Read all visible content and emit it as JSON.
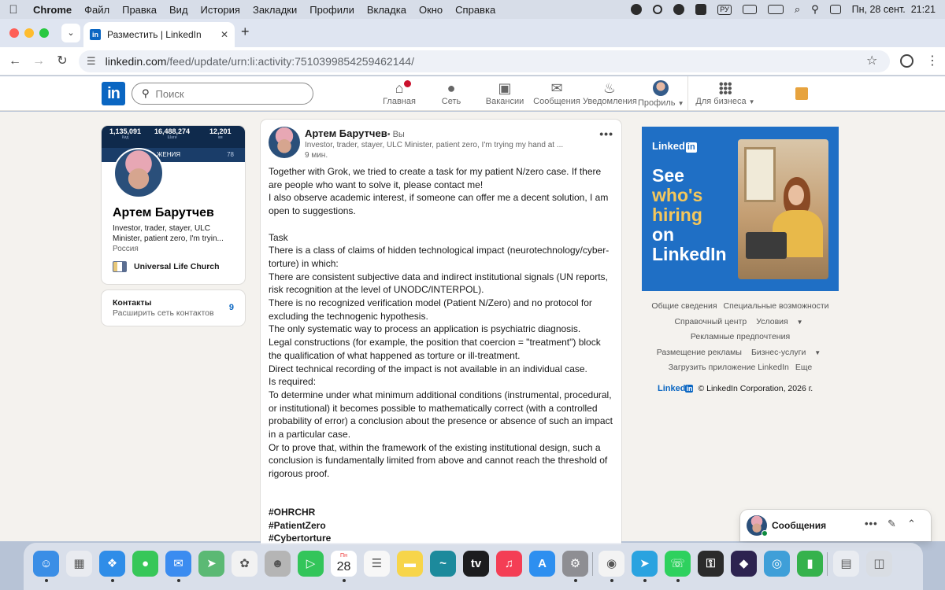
{
  "menubar": {
    "app": "Chrome",
    "items": [
      "Файл",
      "Правка",
      "Вид",
      "История",
      "Закладки",
      "Профили",
      "Вкладка",
      "Окно",
      "Справка"
    ],
    "input_lang": "РУ",
    "datetime": "Пн, 28 сент.  21:21"
  },
  "browser": {
    "tab_title": "Разместить | LinkedIn",
    "favicon_text": "in",
    "url_domain": "linkedin.com",
    "url_path": "/feed/update/urn:li:activity:7510399854259462144/"
  },
  "linkedin": {
    "logo": "in",
    "search_placeholder": "Поиск",
    "nav": {
      "home": "Главная",
      "network": "Сеть",
      "jobs": "Вакансии",
      "messaging": "Сообщения",
      "notifications": "Уведомления",
      "profile": "Профиль",
      "business": "Для бизнеса"
    },
    "profile_card": {
      "banner_stats": [
        {
          "value": "1,135,091",
          "label": "Кид"
        },
        {
          "value": "16,488,274",
          "label": "Шаги"
        },
        {
          "value": "12,201",
          "label": "км"
        }
      ],
      "banner_text": "ЖЕНИЯ",
      "banner_number": "78",
      "name": "Артем Барутчев",
      "headline": "Investor, trader, stayer, ULC Minister, patient zero, I'm tryin...",
      "location": "Россия",
      "organization": "Universal Life Church"
    },
    "contacts_card": {
      "title": "Контакты",
      "subtitle": "Расширить сеть контактов",
      "count": "9"
    },
    "post": {
      "author": "Артем Барутчев",
      "you_label": "• Вы",
      "headline": "Investor, trader, stayer, ULC Minister, patient zero, I'm trying my hand at ...",
      "time": "9 мин.",
      "lines": [
        "Together with Grok, we tried to create a task for my patient N/zero case. If there are people who want to solve it, please contact me!",
        "I also observe academic interest, if someone can offer me a decent solution, I am open to suggestions.",
        "",
        "Task",
        "There is a class of claims of hidden technological impact (neurotechnology/cyber-torture) in which:",
        "There are consistent subjective data and indirect institutional signals (UN reports, risk recognition at the level of UNODC/INTERPOL).",
        "There is no recognized verification model (Patient N/Zero) and no protocol for excluding the technogenic hypothesis.",
        "The only systematic way to process an application is psychiatric diagnosis.",
        "Legal constructions (for example, the position that coercion = \"treatment\") block the qualification of what happened as torture or ill-treatment.",
        "Direct technical recording of the impact is not available in an individual case.",
        "Is required:",
        "To determine under what minimum additional conditions (instrumental, procedural, or institutional) it becomes possible to mathematically correct (with a controlled probability of error) a conclusion about the presence or absence of such an impact in a particular case.",
        "Or to prove that, within the framework of the existing institutional design, such a conclusion is fundamentally limited from above and cannot reach the threshold of rigorous proof."
      ],
      "hashtags": [
        "#OHRCHR",
        "#PatientZero",
        "#Cybertorture"
      ]
    },
    "ad": {
      "brand": "Linked",
      "brand_in": "in",
      "line1": "See",
      "line2": "who's",
      "line3": "hiring",
      "line4": "on",
      "line5": "LinkedIn"
    },
    "footer": {
      "about": "Общие сведения",
      "accessibility": "Специальные возможности",
      "help": "Справочный центр",
      "terms": "Условия",
      "ad_prefs": "Рекламные предпочтения",
      "advertising": "Размещение рекламы",
      "business": "Бизнес-услуги",
      "get_app": "Загрузить приложение LinkedIn",
      "more": "Еще",
      "brand": "Linked",
      "brand_in": "in",
      "copyright": "© LinkedIn Corporation, 2026 г."
    },
    "messaging_widget": {
      "title": "Сообщения"
    }
  },
  "dock": {
    "calendar_month": "Пн",
    "calendar_day": "28",
    "apps": [
      {
        "name": "finder",
        "color": "#3a8ee6"
      },
      {
        "name": "launchpad",
        "color": "#e9ebf0"
      },
      {
        "name": "safari",
        "color": "#2f8de8"
      },
      {
        "name": "messages",
        "color": "#37c759"
      },
      {
        "name": "mail",
        "color": "#3b8cf0"
      },
      {
        "name": "maps",
        "color": "#5bb974"
      },
      {
        "name": "photos",
        "color": "#f2f2f2"
      },
      {
        "name": "contacts",
        "color": "#b5b5b5"
      },
      {
        "name": "facetime",
        "color": "#33c55a"
      },
      {
        "name": "calendar",
        "color": "#ffffff"
      },
      {
        "name": "reminders",
        "color": "#f7f7f7"
      },
      {
        "name": "notes",
        "color": "#f7d54a"
      },
      {
        "name": "freeform",
        "color": "#1c8a9c"
      },
      {
        "name": "tv",
        "color": "#1c1c1e"
      },
      {
        "name": "music",
        "color": "#f43e55"
      },
      {
        "name": "app-store",
        "color": "#2d8ff0"
      },
      {
        "name": "system-settings",
        "color": "#8e8e93"
      },
      {
        "name": "chrome",
        "color": "#f3f3f3"
      },
      {
        "name": "telegram",
        "color": "#2aa3e0"
      },
      {
        "name": "whatsapp",
        "color": "#2ed15e"
      },
      {
        "name": "keychain",
        "color": "#2b2b2b"
      },
      {
        "name": "obsidian",
        "color": "#2d2350"
      },
      {
        "name": "edge",
        "color": "#3f9fd8"
      },
      {
        "name": "numbers",
        "color": "#35b24c"
      },
      {
        "name": "downloads",
        "color": "#e9ecf1"
      },
      {
        "name": "trash",
        "color": "#d9dde3"
      }
    ]
  }
}
